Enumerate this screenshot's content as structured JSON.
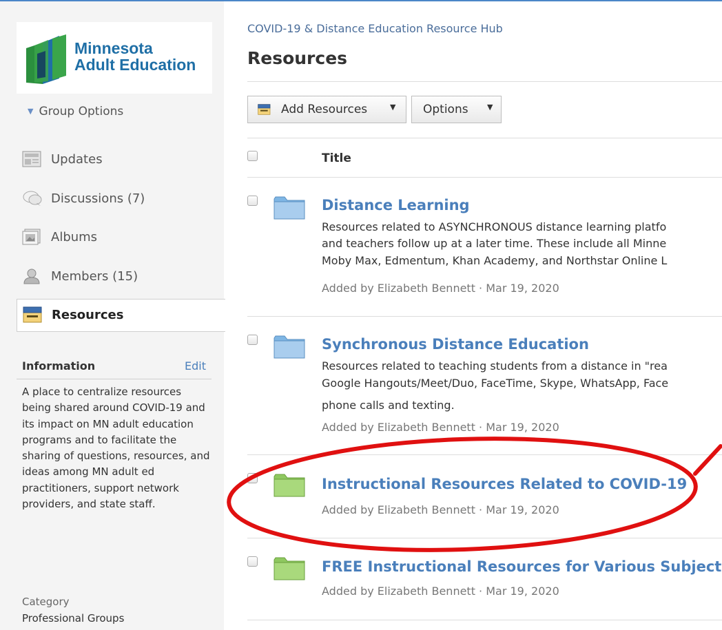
{
  "sidebar": {
    "logo": {
      "line1": "Minnesota",
      "line2": "Adult Education"
    },
    "group_options": "Group Options",
    "nav": [
      {
        "label": "Updates",
        "icon": "updates-icon"
      },
      {
        "label": "Discussions (7)",
        "icon": "discussions-icon"
      },
      {
        "label": "Albums",
        "icon": "albums-icon"
      },
      {
        "label": "Members (15)",
        "icon": "members-icon"
      },
      {
        "label": "Resources",
        "icon": "resources-icon",
        "active": true
      }
    ],
    "info": {
      "title": "Information",
      "edit": "Edit",
      "description": "A place to centralize resources being shared around COVID-19 and its impact on MN adult education programs and to facilitate the sharing of questions, resources, and ideas among MN adult ed practitioners, support network providers, and state staff.",
      "category_label": "Category",
      "category_value": "Professional Groups"
    }
  },
  "main": {
    "breadcrumb": "COVID-19 & Distance Education Resource Hub",
    "title": "Resources",
    "toolbar": {
      "add_label": "Add Resources",
      "options_label": "Options"
    },
    "table_header": "Title",
    "resources": [
      {
        "title": "Distance Learning",
        "folder_color": "#7fb6e4",
        "description": [
          "Resources related to ASYNCHRONOUS distance learning platfo",
          "and teachers follow up at a later time.  These include all Minne",
          "Moby Max, Edmentum, Khan Academy, and Northstar Online L"
        ],
        "meta": "Added by Elizabeth Bennett · Mar 19, 2020"
      },
      {
        "title": "Synchronous Distance Education",
        "folder_color": "#7fb6e4",
        "description": [
          "Resources related to teaching students from a distance in \"rea",
          "Google Hangouts/Meet/Duo, FaceTime, Skype, WhatsApp, Face",
          "phone calls and texting."
        ],
        "meta": "Added by Elizabeth Bennett · Mar 19, 2020"
      },
      {
        "title": "Instructional Resources Related to COVID-19",
        "folder_color": "#8fc860",
        "description": [],
        "meta": "Added by Elizabeth Bennett · Mar 19, 2020"
      },
      {
        "title": "FREE Instructional Resources for Various Subjects",
        "folder_color": "#8fc860",
        "description": [],
        "meta": "Added by Elizabeth Bennett · Mar 19, 2020"
      }
    ]
  },
  "colors": {
    "accent": "#4a7fbb",
    "annotation": "#e01010",
    "logo_green": "#3a9a3a",
    "logo_blue": "#1f6fa6"
  }
}
